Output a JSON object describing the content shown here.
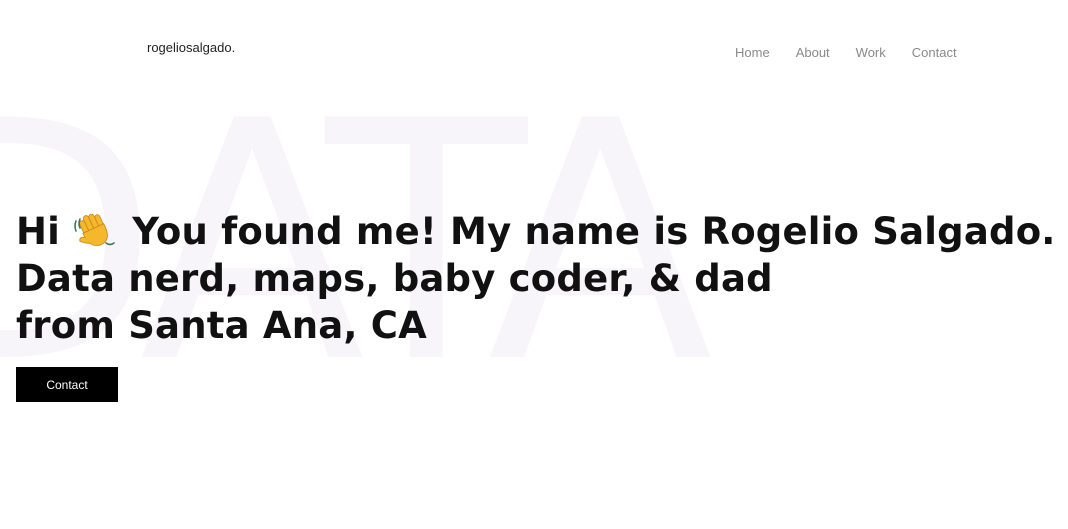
{
  "background_word": "DATA",
  "header": {
    "logo": "rogeliosalgado.",
    "nav": [
      "Home",
      "About",
      "Work",
      "Contact"
    ]
  },
  "hero": {
    "line1_before_icon": "Hi",
    "icon": "waving-hand-icon",
    "line1_after_icon": "You found me! My name is Rogelio Salgado.",
    "line2": "Data nerd, maps, baby coder, & dad",
    "line3": "from Santa Ana, CA",
    "cta_label": "Contact"
  },
  "colors": {
    "text": "#111111",
    "nav": "#8a8a8a",
    "button_bg": "#000000",
    "button_text": "#ffffff",
    "watermark": "#f7f4fa"
  }
}
